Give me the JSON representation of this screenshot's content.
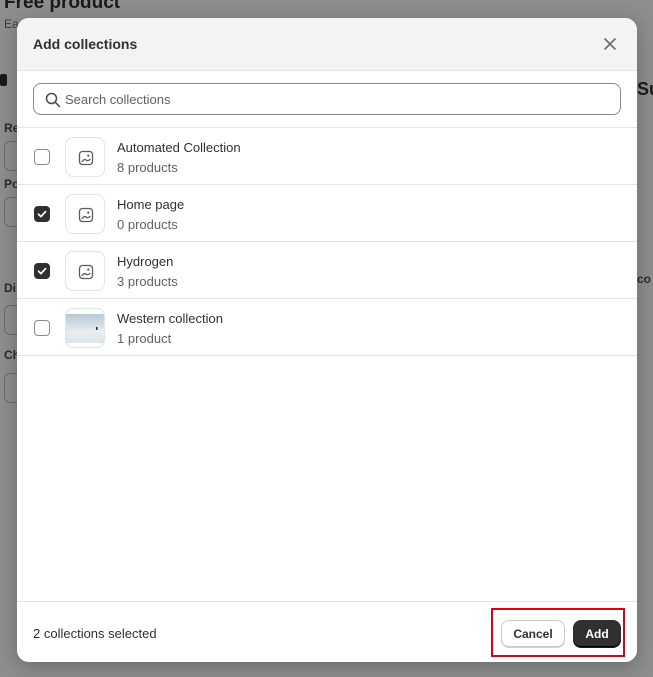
{
  "background": {
    "title": "Free product",
    "subtitle": "Ea",
    "fragments": [
      "Re",
      "Po",
      "Di",
      "Ch",
      "Su",
      "co"
    ]
  },
  "modal": {
    "title": "Add collections",
    "close_icon": "close-icon"
  },
  "search": {
    "placeholder": "Search collections",
    "value": "",
    "icon": "search-icon"
  },
  "collections": [
    {
      "name": "Automated Collection",
      "count": "8 products",
      "checked": false,
      "thumbnail": "image-placeholder-icon"
    },
    {
      "name": "Home page",
      "count": "0 products",
      "checked": true,
      "thumbnail": "image-placeholder-icon"
    },
    {
      "name": "Hydrogen",
      "count": "3 products",
      "checked": true,
      "thumbnail": "image-placeholder-icon"
    },
    {
      "name": "Western collection",
      "count": "1 product",
      "checked": false,
      "thumbnail": "photo"
    }
  ],
  "footer": {
    "selected_text": "2 collections selected",
    "cancel_label": "Cancel",
    "add_label": "Add"
  },
  "colors": {
    "primary_button": "#303030",
    "highlight": "#e00010"
  }
}
